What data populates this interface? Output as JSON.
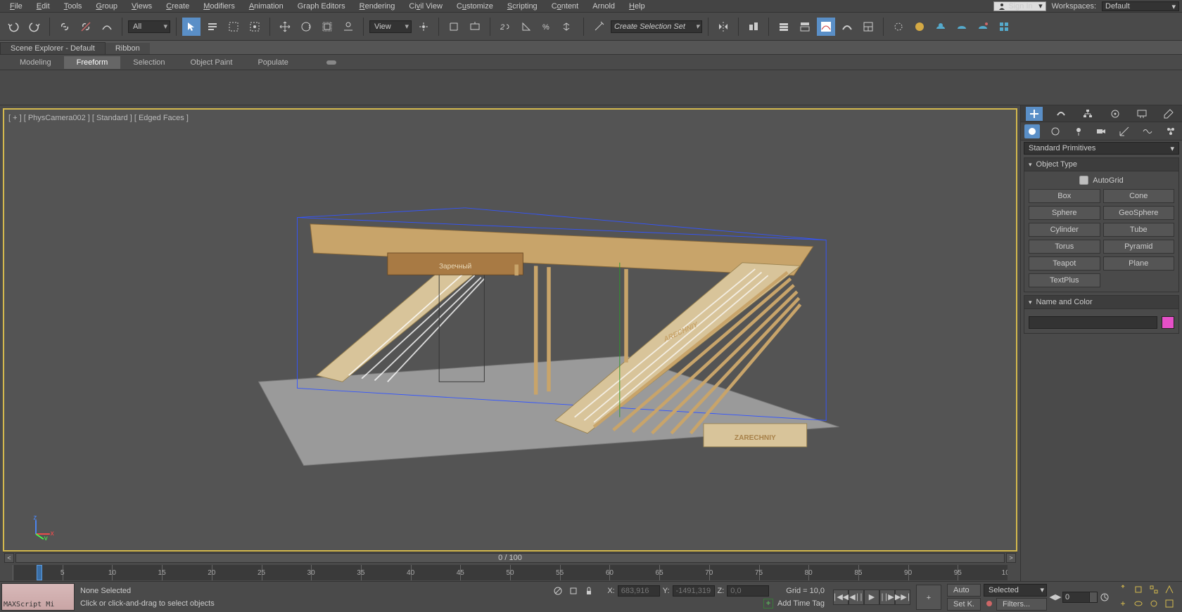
{
  "menu": {
    "items": [
      "File",
      "Edit",
      "Tools",
      "Group",
      "Views",
      "Create",
      "Modifiers",
      "Animation",
      "Graph Editors",
      "Rendering",
      "Civil View",
      "Customize",
      "Scripting",
      "Content",
      "Arnold",
      "Help"
    ],
    "underlines": [
      "F",
      "E",
      "T",
      "G",
      "V",
      "C",
      "M",
      "A",
      "G",
      "R",
      "C",
      "C",
      "S",
      "C",
      "A",
      "H"
    ]
  },
  "signin": "Sign In",
  "workspaces_label": "Workspaces:",
  "workspace": "Default",
  "toolbar": {
    "all": "All",
    "view": "View",
    "selset": "Create Selection Set"
  },
  "tabs": {
    "scene": "Scene Explorer - Default",
    "ribbon": "Ribbon"
  },
  "subtabs": [
    "Modeling",
    "Freeform",
    "Selection",
    "Object Paint",
    "Populate"
  ],
  "subtab_active": 1,
  "viewport": {
    "label": "[ + ] [ PhysCamera002 ] [ Standard ] [ Edged Faces ]"
  },
  "timeline": {
    "range": "0 / 100",
    "start": 0,
    "end": 100,
    "step": 5
  },
  "status": {
    "maxscript": "MAXScript Mi",
    "selection": "None Selected",
    "prompt": "Click or click-and-drag to select objects",
    "x_label": "X:",
    "x": "683,916",
    "y_label": "Y:",
    "y": "-1491,319",
    "z_label": "Z:",
    "z": "0,0",
    "grid": "Grid = 10,0",
    "addtag": "Add Time Tag",
    "frame": "0",
    "auto": "Auto",
    "setk": "Set K.",
    "selected": "Selected",
    "filters": "Filters..."
  },
  "cmdpanel": {
    "dropdown": "Standard Primitives",
    "rollout1": "Object Type",
    "autogrid": "AutoGrid",
    "buttons": [
      "Box",
      "Cone",
      "Sphere",
      "GeoSphere",
      "Cylinder",
      "Tube",
      "Torus",
      "Pyramid",
      "Teapot",
      "Plane",
      "TextPlus"
    ],
    "rollout2": "Name and Color"
  }
}
